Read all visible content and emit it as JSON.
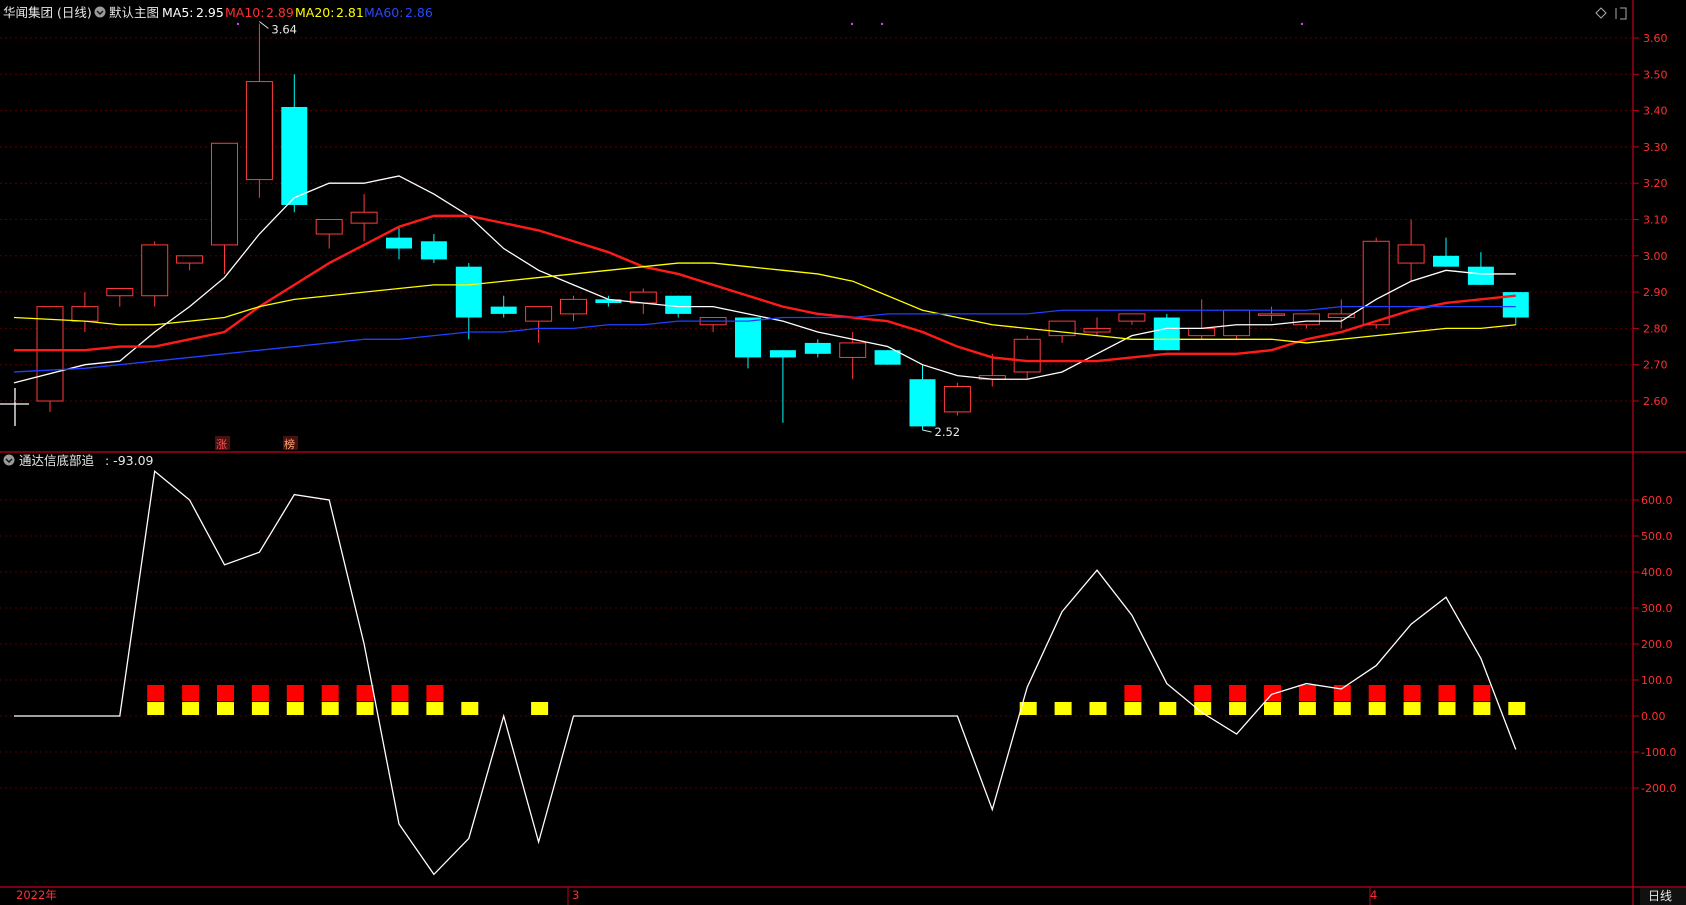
{
  "header": {
    "stock_name": "华闻集团 (日线)",
    "template_label": "默认主图",
    "ma5_label": "MA5:",
    "ma5_value": "2.95",
    "ma10_label": "MA10:",
    "ma10_value": "2.89",
    "ma20_label": "MA20:",
    "ma20_value": "2.81",
    "ma60_label": "MA60:",
    "ma60_value": "2.86"
  },
  "indicator_header": {
    "name": "通达信底部追",
    "value_text": ": -93.09"
  },
  "bottom_bar": {
    "year_label": "2022年",
    "month_label_1": "3",
    "month_label_2": "4",
    "period_button": "日线"
  },
  "markers": {
    "zhang": "涨",
    "bang": "榜"
  },
  "colors": {
    "up": "#ff3b3b",
    "down": "#00ffff",
    "ma5": "#ffffff",
    "ma10": "#ff1a1a",
    "ma20": "#ffff00",
    "ma60": "#2040ff",
    "axis": "#c0001c",
    "grid": "#5a0000"
  },
  "chart_data": [
    {
      "type": "candlestick",
      "title": "华闻集团 (日线)",
      "price_axis_ticks": [
        "3.60",
        "3.50",
        "3.40",
        "3.30",
        "3.20",
        "3.10",
        "3.00",
        "2.90",
        "2.80",
        "2.70",
        "2.60"
      ],
      "ylim": [
        2.52,
        3.64
      ],
      "annotations": {
        "high_label": "3.64",
        "low_label": "2.52"
      },
      "candles": [
        [
          2.6,
          2.86,
          2.57,
          2.86
        ],
        [
          2.82,
          2.9,
          2.79,
          2.86
        ],
        [
          2.89,
          2.91,
          2.86,
          2.91
        ],
        [
          2.89,
          3.04,
          2.86,
          3.03
        ],
        [
          2.98,
          3.0,
          2.96,
          3.0
        ],
        [
          3.03,
          3.31,
          2.95,
          3.31
        ],
        [
          3.21,
          3.64,
          3.16,
          3.48
        ],
        [
          3.41,
          3.5,
          3.12,
          3.14
        ],
        [
          3.06,
          3.1,
          3.02,
          3.1
        ],
        [
          3.09,
          3.17,
          3.04,
          3.12
        ],
        [
          3.05,
          3.08,
          2.99,
          3.02
        ],
        [
          3.04,
          3.06,
          2.98,
          2.99
        ],
        [
          2.97,
          2.98,
          2.77,
          2.83
        ],
        [
          2.86,
          2.89,
          2.83,
          2.84
        ],
        [
          2.82,
          2.86,
          2.76,
          2.86
        ],
        [
          2.84,
          2.89,
          2.82,
          2.88
        ],
        [
          2.88,
          2.89,
          2.86,
          2.87
        ],
        [
          2.87,
          2.91,
          2.84,
          2.9
        ],
        [
          2.89,
          2.89,
          2.83,
          2.84
        ],
        [
          2.81,
          2.83,
          2.79,
          2.83
        ],
        [
          2.83,
          2.83,
          2.69,
          2.72
        ],
        [
          2.74,
          2.74,
          2.54,
          2.72
        ],
        [
          2.76,
          2.77,
          2.72,
          2.73
        ],
        [
          2.72,
          2.79,
          2.66,
          2.76
        ],
        [
          2.74,
          2.74,
          2.7,
          2.7
        ],
        [
          2.66,
          2.7,
          2.52,
          2.53
        ],
        [
          2.57,
          2.65,
          2.56,
          2.64
        ],
        [
          2.66,
          2.73,
          2.64,
          2.67
        ],
        [
          2.68,
          2.78,
          2.66,
          2.77
        ],
        [
          2.78,
          2.82,
          2.76,
          2.82
        ],
        [
          2.79,
          2.83,
          2.78,
          2.8
        ],
        [
          2.82,
          2.84,
          2.81,
          2.84
        ],
        [
          2.83,
          2.84,
          2.74,
          2.74
        ],
        [
          2.78,
          2.88,
          2.77,
          2.8
        ],
        [
          2.78,
          2.85,
          2.77,
          2.85
        ],
        [
          2.84,
          2.86,
          2.82,
          2.84
        ],
        [
          2.81,
          2.84,
          2.8,
          2.84
        ],
        [
          2.83,
          2.88,
          2.8,
          2.84
        ],
        [
          2.81,
          3.05,
          2.8,
          3.04
        ],
        [
          2.98,
          3.1,
          2.93,
          3.03
        ],
        [
          3.0,
          3.05,
          2.97,
          2.97
        ],
        [
          2.97,
          3.01,
          2.92,
          2.92
        ],
        [
          2.9,
          2.9,
          2.81,
          2.83
        ]
      ],
      "series": [
        {
          "name": "MA5",
          "values": [
            2.65,
            2.7,
            2.71,
            2.79,
            2.86,
            2.94,
            3.06,
            3.16,
            3.2,
            3.2,
            3.22,
            3.17,
            3.11,
            3.02,
            2.96,
            2.92,
            2.88,
            2.87,
            2.86,
            2.86,
            2.84,
            2.82,
            2.79,
            2.77,
            2.75,
            2.7,
            2.67,
            2.66,
            2.66,
            2.68,
            2.73,
            2.78,
            2.8,
            2.8,
            2.81,
            2.81,
            2.82,
            2.82,
            2.88,
            2.93,
            2.96,
            2.95,
            2.95
          ]
        },
        {
          "name": "MA10",
          "values": [
            2.74,
            2.74,
            2.75,
            2.75,
            2.77,
            2.79,
            2.86,
            2.92,
            2.98,
            3.03,
            3.08,
            3.11,
            3.11,
            3.09,
            3.07,
            3.04,
            3.01,
            2.97,
            2.95,
            2.92,
            2.89,
            2.86,
            2.84,
            2.83,
            2.82,
            2.79,
            2.75,
            2.72,
            2.71,
            2.71,
            2.71,
            2.72,
            2.73,
            2.73,
            2.73,
            2.74,
            2.77,
            2.79,
            2.82,
            2.85,
            2.87,
            2.88,
            2.89
          ]
        },
        {
          "name": "MA20",
          "values": [
            2.83,
            2.82,
            2.81,
            2.81,
            2.82,
            2.83,
            2.86,
            2.88,
            2.89,
            2.9,
            2.91,
            2.92,
            2.92,
            2.93,
            2.94,
            2.95,
            2.96,
            2.97,
            2.98,
            2.98,
            2.97,
            2.96,
            2.95,
            2.93,
            2.89,
            2.85,
            2.83,
            2.81,
            2.8,
            2.79,
            2.78,
            2.77,
            2.77,
            2.77,
            2.77,
            2.77,
            2.76,
            2.77,
            2.78,
            2.79,
            2.8,
            2.8,
            2.81
          ]
        },
        {
          "name": "MA60",
          "values": [
            2.68,
            2.69,
            2.7,
            2.71,
            2.72,
            2.73,
            2.74,
            2.75,
            2.76,
            2.77,
            2.77,
            2.78,
            2.79,
            2.79,
            2.8,
            2.8,
            2.81,
            2.81,
            2.82,
            2.82,
            2.82,
            2.83,
            2.83,
            2.83,
            2.84,
            2.84,
            2.84,
            2.84,
            2.84,
            2.85,
            2.85,
            2.85,
            2.85,
            2.85,
            2.85,
            2.85,
            2.85,
            2.86,
            2.86,
            2.86,
            2.86,
            2.86,
            2.86
          ]
        }
      ]
    },
    {
      "type": "line",
      "title": "通达信底部追",
      "y_axis_ticks": [
        "600.0",
        "500.0",
        "400.0",
        "300.0",
        "200.0",
        "100.0",
        "0.00",
        "-100.0",
        "-200.0"
      ],
      "ylim": [
        -450,
        700
      ],
      "series": [
        {
          "name": "通达信底部追",
          "values": [
            0,
            0,
            0,
            680,
            600,
            420,
            455,
            615,
            600,
            200,
            -300,
            -440,
            -340,
            0,
            -350,
            0,
            0,
            0,
            0,
            0,
            0,
            0,
            0,
            0,
            0,
            0,
            0,
            -260,
            80,
            290,
            405,
            280,
            90,
            10,
            -50,
            60,
            90,
            75,
            140,
            255,
            330,
            160,
            -93.09
          ]
        }
      ],
      "red_bar_days": [
        3,
        4,
        5,
        6,
        7,
        8,
        9,
        10,
        11,
        31,
        33,
        34,
        35,
        36,
        37,
        38,
        39,
        40,
        41
      ],
      "yellow_bar_days": [
        3,
        4,
        5,
        6,
        7,
        8,
        9,
        10,
        11,
        12,
        14,
        28,
        29,
        30,
        31,
        32,
        33,
        34,
        35,
        36,
        37,
        38,
        39,
        40,
        41,
        42
      ]
    }
  ]
}
